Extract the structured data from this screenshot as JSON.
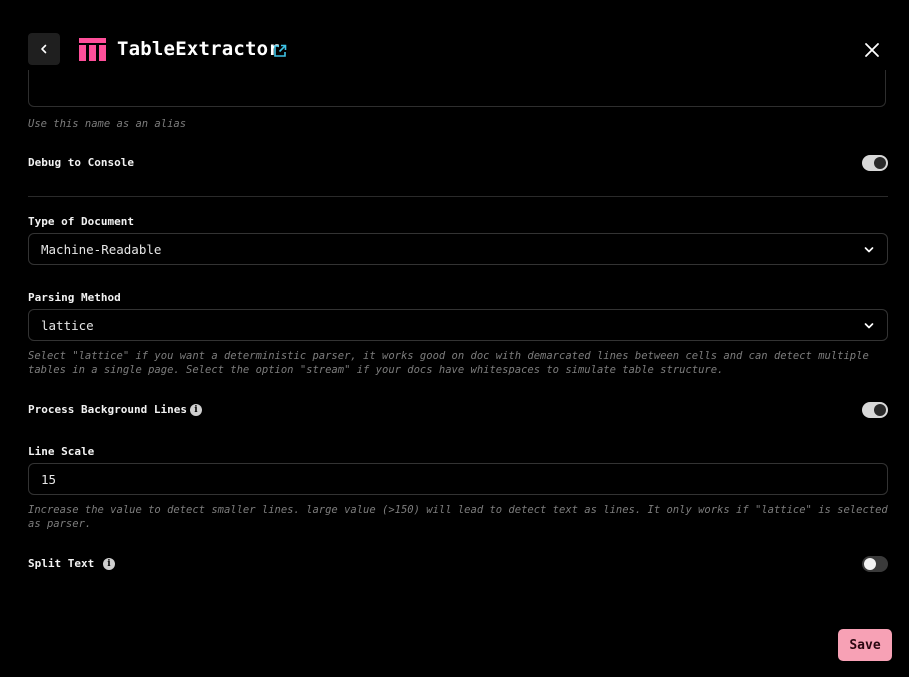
{
  "header": {
    "back_icon": "chevron-left-icon",
    "logo_icon": "table-extractor-logo",
    "title": "TableExtractor",
    "external_link_icon": "external-link-icon",
    "close_icon": "close-icon"
  },
  "alias": {
    "hint": "Use this name as an alias"
  },
  "debug": {
    "label": "Debug to Console",
    "enabled": true
  },
  "document_type": {
    "label": "Type of Document",
    "value": "Machine-Readable"
  },
  "parsing_method": {
    "label": "Parsing Method",
    "value": "lattice",
    "hint": "Select \"lattice\" if you want a deterministic parser, it works good on doc with demarcated lines between cells and can detect multiple tables in a single page. Select the option \"stream\" if your docs have whitespaces to simulate table structure."
  },
  "process_background_lines": {
    "label": "Process Background Lines",
    "enabled": true
  },
  "line_scale": {
    "label": "Line Scale",
    "value": "15",
    "hint": "Increase the value to detect smaller lines. large value (>150) will lead to detect text as lines. It only works if \"lattice\" is selected as parser."
  },
  "split_text": {
    "label": "Split Text",
    "enabled": false
  },
  "footer": {
    "save_label": "Save"
  },
  "colors": {
    "background": "#000000",
    "logo": "#ff4f9a",
    "link": "#3fc3e6",
    "save_button": "#f7a1b5"
  }
}
